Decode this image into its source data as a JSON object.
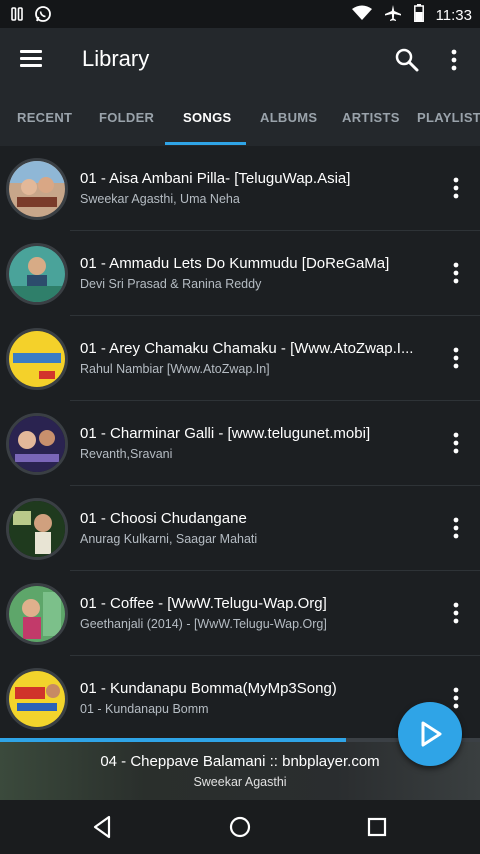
{
  "status_bar": {
    "time": "11:33",
    "left_icons": [
      "pause-icon",
      "whatsapp-icon"
    ],
    "right_icons": [
      "wifi-icon",
      "airplane-icon",
      "battery-icon"
    ]
  },
  "app_bar": {
    "title": "Library",
    "icons": [
      "menu-icon",
      "search-icon",
      "more-vert-icon"
    ]
  },
  "tabs": [
    {
      "label": "RECENT",
      "active": false
    },
    {
      "label": "FOLDER",
      "active": false
    },
    {
      "label": "SONGS",
      "active": true
    },
    {
      "label": "ALBUMS",
      "active": false
    },
    {
      "label": "ARTISTS",
      "active": false
    },
    {
      "label": "PLAYLISTS",
      "active": false
    }
  ],
  "songs": [
    {
      "title": "01 - Aisa Ambani Pilla- [TeluguWap.Asia]",
      "artist": "Sweekar Agasthi, Uma Neha"
    },
    {
      "title": "01 - Ammadu Lets Do Kummudu [DoReGaMa]",
      "artist": "Devi Sri Prasad & Ranina Reddy"
    },
    {
      "title": "01 - Arey Chamaku Chamaku - [Www.AtoZwap.I...",
      "artist": "Rahul Nambiar [Www.AtoZwap.In]"
    },
    {
      "title": "01 - Charminar Galli - [www.telugunet.mobi]",
      "artist": "Revanth,Sravani"
    },
    {
      "title": "01 - Choosi Chudangane",
      "artist": "Anurag Kulkarni, Saagar Mahati"
    },
    {
      "title": "01 - Coffee - [WwW.Telugu-Wap.Org]",
      "artist": "Geethanjali (2014) - [WwW.Telugu-Wap.Org]"
    },
    {
      "title": "01 - Kundanapu Bomma(MyMp3Song)",
      "artist": "01 - Kundanapu Bomm"
    }
  ],
  "now_playing": {
    "title": "04 - Cheppave Balamani :: bnbplayer.com",
    "artist": "Sweekar Agasthi",
    "progress_fraction": 0.72
  },
  "colors": {
    "accent": "#2fa4e7",
    "background": "#1c1f22",
    "app_bar": "#24282c"
  }
}
